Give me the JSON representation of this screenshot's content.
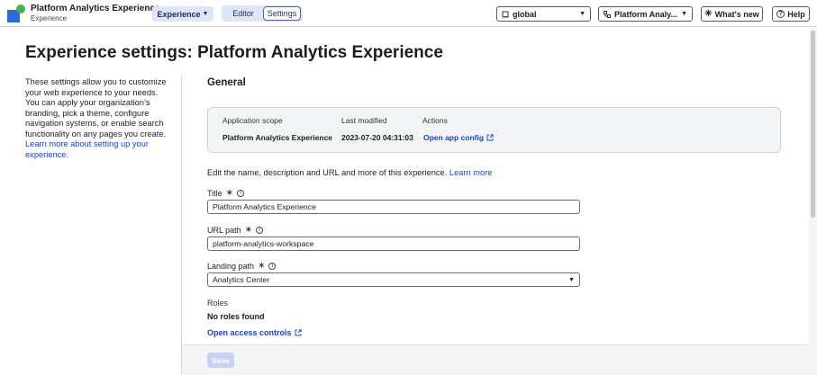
{
  "app": {
    "title": "Platform Analytics Experience",
    "subtitle": "Experience",
    "experience_menu_label": "Experience",
    "tabs": [
      {
        "label": "Editor",
        "selected": false
      },
      {
        "label": "Settings",
        "selected": true
      }
    ],
    "scope_select": {
      "icon": "scope-icon",
      "value": "global"
    },
    "app_select": {
      "icon": "app-icon",
      "value": "Platform Analy..."
    },
    "whats_new_label": "What's new",
    "help_label": "Help"
  },
  "page": {
    "title": "Experience settings: Platform Analytics Experience",
    "description": "These settings allow you to customize your web experience to your needs. You can apply your organization’s branding, pick a theme, configure navigation systems, or enable search functionality on any pages you create.",
    "description_link": "Learn more about setting up your experience."
  },
  "general": {
    "section_title": "General",
    "info_card": {
      "headers": [
        "Application scope",
        "Last modified",
        "Actions"
      ],
      "application_scope": "Platform Analytics Experience",
      "last_modified": "2023-07-20 04:31:03",
      "action_link": "Open app config"
    },
    "edit_text": "Edit the name, description and URL and more of this experience.",
    "edit_link": "Learn more",
    "fields": {
      "title": {
        "label": "Title",
        "value": "Platform Analytics Experience"
      },
      "url_path": {
        "label": "URL path",
        "value": "platform-analytics-workspace"
      },
      "landing_path": {
        "label": "Landing path",
        "value": "Analytics Center"
      }
    },
    "roles": {
      "label": "Roles",
      "value": "No roles found"
    },
    "access_link": "Open access controls"
  },
  "footer": {
    "save_label": "Save"
  },
  "colors": {
    "accent": "#1a45b0",
    "save_disabled": "#c7d3f0",
    "tab_bg": "#dfe6f7"
  }
}
